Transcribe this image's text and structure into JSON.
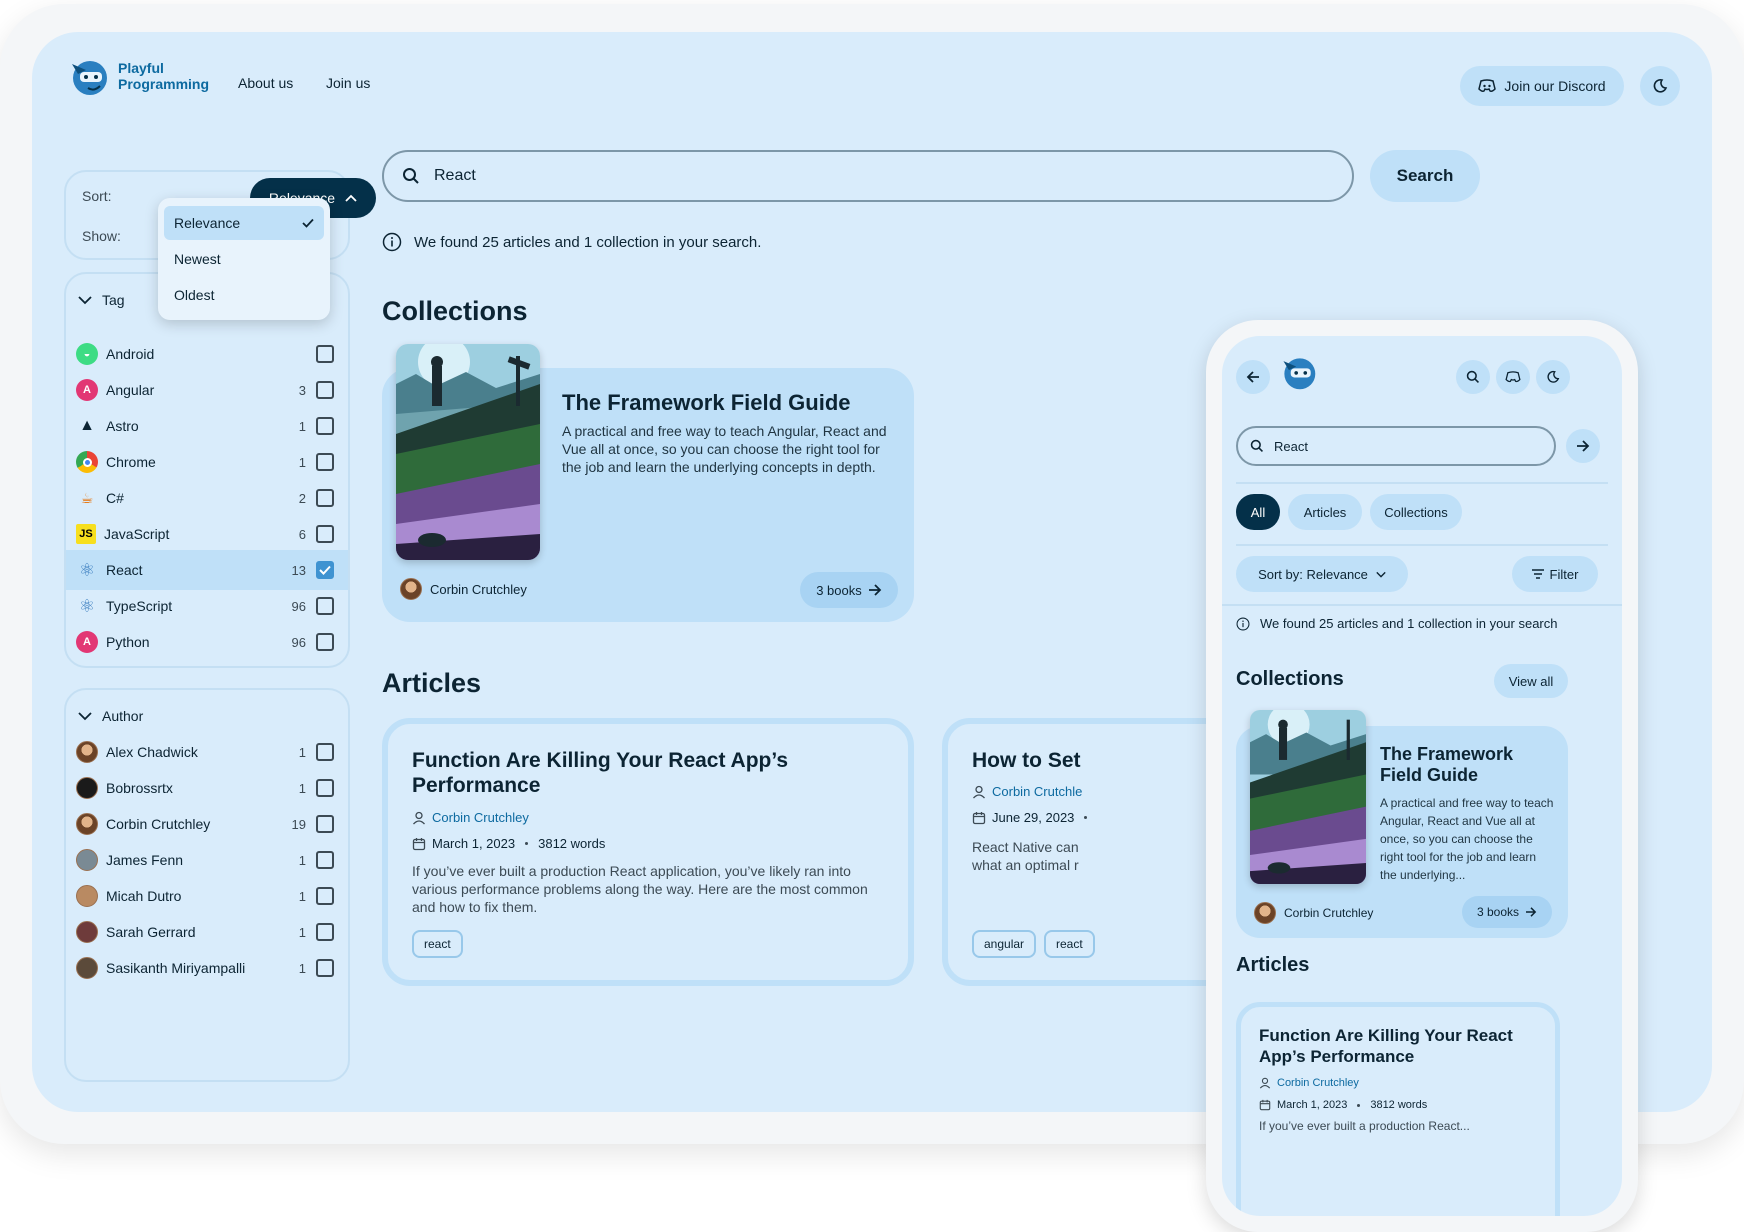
{
  "brand": {
    "name": "Playful Programming"
  },
  "nav": {
    "about": "About us",
    "join": "Join us",
    "discord": "Join our Discord"
  },
  "sidebar": {
    "sort_label": "Sort:",
    "show_label": "Show:",
    "sort_value": "Relevance",
    "sort_options": [
      "Relevance",
      "Newest",
      "Oldest"
    ],
    "tag_heading": "Tag",
    "tags": [
      {
        "name": "Android",
        "count": ""
      },
      {
        "name": "Angular",
        "count": "3"
      },
      {
        "name": "Astro",
        "count": "1"
      },
      {
        "name": "Chrome",
        "count": "1"
      },
      {
        "name": "C#",
        "count": "2"
      },
      {
        "name": "JavaScript",
        "count": "6"
      },
      {
        "name": "React",
        "count": "13"
      },
      {
        "name": "TypeScript",
        "count": "96"
      },
      {
        "name": "Python",
        "count": "96"
      }
    ],
    "author_heading": "Author",
    "authors": [
      {
        "name": "Alex Chadwick",
        "count": "1"
      },
      {
        "name": "Bobrossrtx",
        "count": "1"
      },
      {
        "name": "Corbin Crutchley",
        "count": "19"
      },
      {
        "name": "James Fenn",
        "count": "1"
      },
      {
        "name": "Micah Dutro",
        "count": "1"
      },
      {
        "name": "Sarah Gerrard",
        "count": "1"
      },
      {
        "name": "Sasikanth Miriyampalli",
        "count": "1"
      }
    ]
  },
  "search": {
    "value": "React",
    "button": "Search",
    "found": "We found 25 articles and 1 collection in your search."
  },
  "sections": {
    "collections": "Collections",
    "articles": "Articles"
  },
  "collection": {
    "title": "The Framework Field Guide",
    "description": "A practical and free way to teach Angular, React and Vue all at once, so you can choose the right tool for the job and learn the underlying concepts in depth.",
    "author": "Corbin Crutchley",
    "books": "3 books"
  },
  "articles": [
    {
      "title": "Function Are Killing Your React App’s Performance",
      "author": "Corbin Crutchley",
      "date": "March 1, 2023",
      "words": "3812 words",
      "description": "If you’ve ever built a production React application, you’ve likely ran into various performance problems along the way. Here are the most common and how to fix them.",
      "tags": [
        "react"
      ]
    },
    {
      "title": "How to Set",
      "author": "Corbin Crutchle",
      "date": "June 29, 2023",
      "description": "React Native can",
      "description2": "what an optimal r",
      "tags": [
        "angular",
        "react"
      ]
    }
  ],
  "mobile": {
    "search_value": "React",
    "chips": [
      "All",
      "Articles",
      "Collections"
    ],
    "sort": "Sort by: Relevance",
    "filter": "Filter",
    "found": "We found 25 articles and 1 collection in your search",
    "collections": "Collections",
    "view_all": "View all",
    "collection_title": "The Framework Field Guide",
    "collection_desc": "A practical and free way to teach Angular, React and Vue all at once, so you can choose the right tool for the job and learn the underlying...",
    "collection_author": "Corbin Crutchley",
    "books": "3 books",
    "articles": "Articles",
    "article_title": "Function Are Killing Your React App’s Performance",
    "article_author": "Corbin Crutchley",
    "article_date": "March 1, 2023",
    "article_words": "3812 words",
    "article_desc": "If you’ve ever built a production React..."
  },
  "colors": {
    "primary_dark": "#043049",
    "accent_light": "#bfe0f8",
    "background": "#d9ecfb",
    "link": "#0d6aa0"
  }
}
